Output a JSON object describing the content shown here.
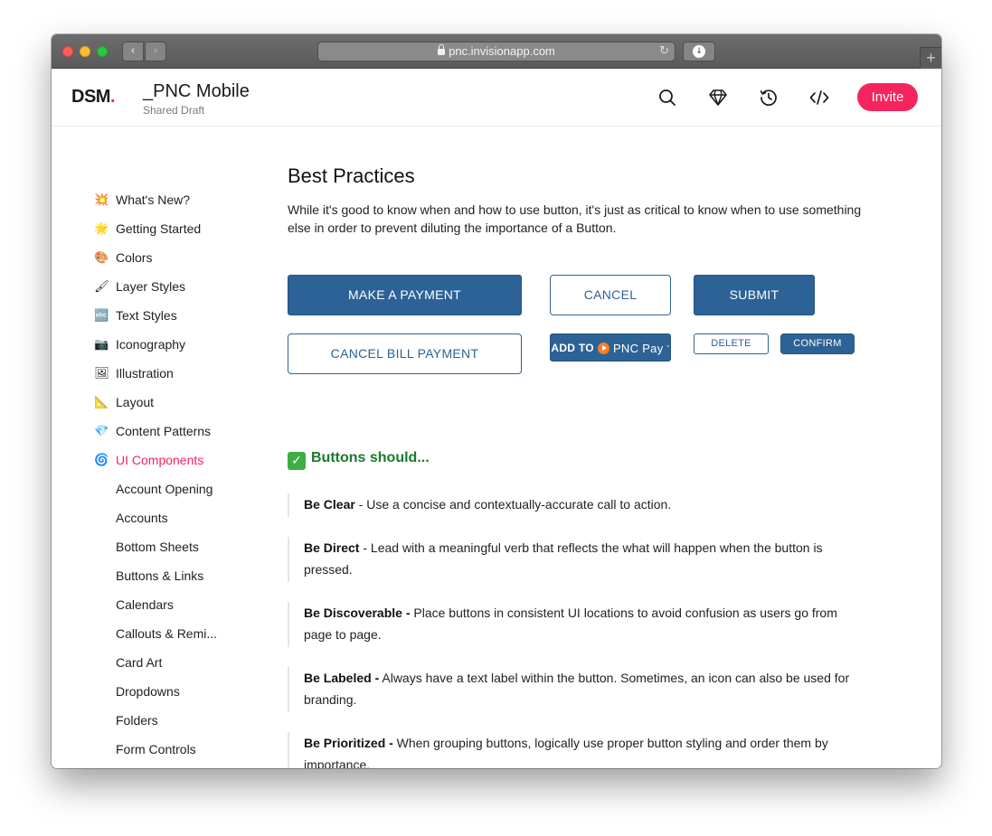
{
  "browser": {
    "url": "pnc.invisionapp.com",
    "back_glyph": "‹",
    "forward_glyph": "›",
    "reload_glyph": "↻",
    "download_glyph": "↓",
    "newtab_glyph": "+"
  },
  "header": {
    "logo_text": "DSM",
    "logo_dot": ".",
    "project_title": "_PNC Mobile",
    "project_subtitle": "Shared Draft",
    "icons": [
      "search-icon",
      "diamond-icon",
      "history-icon",
      "code-icon"
    ],
    "invite_label": "Invite"
  },
  "sidebar": {
    "items": [
      {
        "emoji": "💥",
        "label": "What's New?"
      },
      {
        "emoji": "🌟",
        "label": "Getting Started"
      },
      {
        "emoji": "🎨",
        "label": "Colors"
      },
      {
        "emoji": "🖌",
        "label": "Layer Styles"
      },
      {
        "emoji": "🔤",
        "label": "Text Styles"
      },
      {
        "emoji": "📷",
        "label": "Iconography"
      },
      {
        "emoji": "🖼",
        "label": "Illustration"
      },
      {
        "emoji": "📐",
        "label": "Layout"
      },
      {
        "emoji": "💎",
        "label": "Content Patterns"
      },
      {
        "emoji": "🌀",
        "label": "UI Components",
        "active": true
      }
    ],
    "subitems": [
      "Account Opening",
      "Accounts",
      "Bottom Sheets",
      "Buttons & Links",
      "Calendars",
      "Callouts & Remi...",
      "Card Art",
      "Dropdowns",
      "Folders",
      "Form Controls"
    ]
  },
  "main": {
    "title": "Best Practices",
    "intro": "While it's good to know when and how to use button, it's just as critical to know when to use something else in order to prevent diluting the importance of a Button.",
    "buttons": {
      "make_payment": "MAKE A PAYMENT",
      "cancel": "CANCEL",
      "submit": "SUBMIT",
      "cancel_bill_payment": "CANCEL BILL PAYMENT",
      "add_to": "ADD TO",
      "pnc_pay": "PNC Pay",
      "pnc_pay_mark": "°",
      "delete": "DELETE",
      "confirm": "CONFIRM"
    },
    "should_heading": "Buttons should...",
    "check_glyph": "✓",
    "practices": [
      {
        "term": "Be Clear",
        "text": " - Use a concise and contextually-accurate call to action."
      },
      {
        "term": "Be Direct",
        "text": " - Lead with a meaningful verb that reflects the what will happen when the button is pressed."
      },
      {
        "term": "Be Discoverable -",
        "text": " Place buttons in consistent UI locations to avoid confusion as users go from page to page."
      },
      {
        "term": "Be Labeled -",
        "text": " Always have a text label within the button. Sometimes, an icon can also be used for branding."
      },
      {
        "term": "Be Prioritized -",
        "text": " When grouping buttons, logically use proper button styling and order them by importance."
      }
    ]
  },
  "colors": {
    "brand_pink": "#f5245f",
    "pnc_blue": "#2d6296",
    "success_green": "#197a2a",
    "pnc_orange": "#f58025"
  }
}
